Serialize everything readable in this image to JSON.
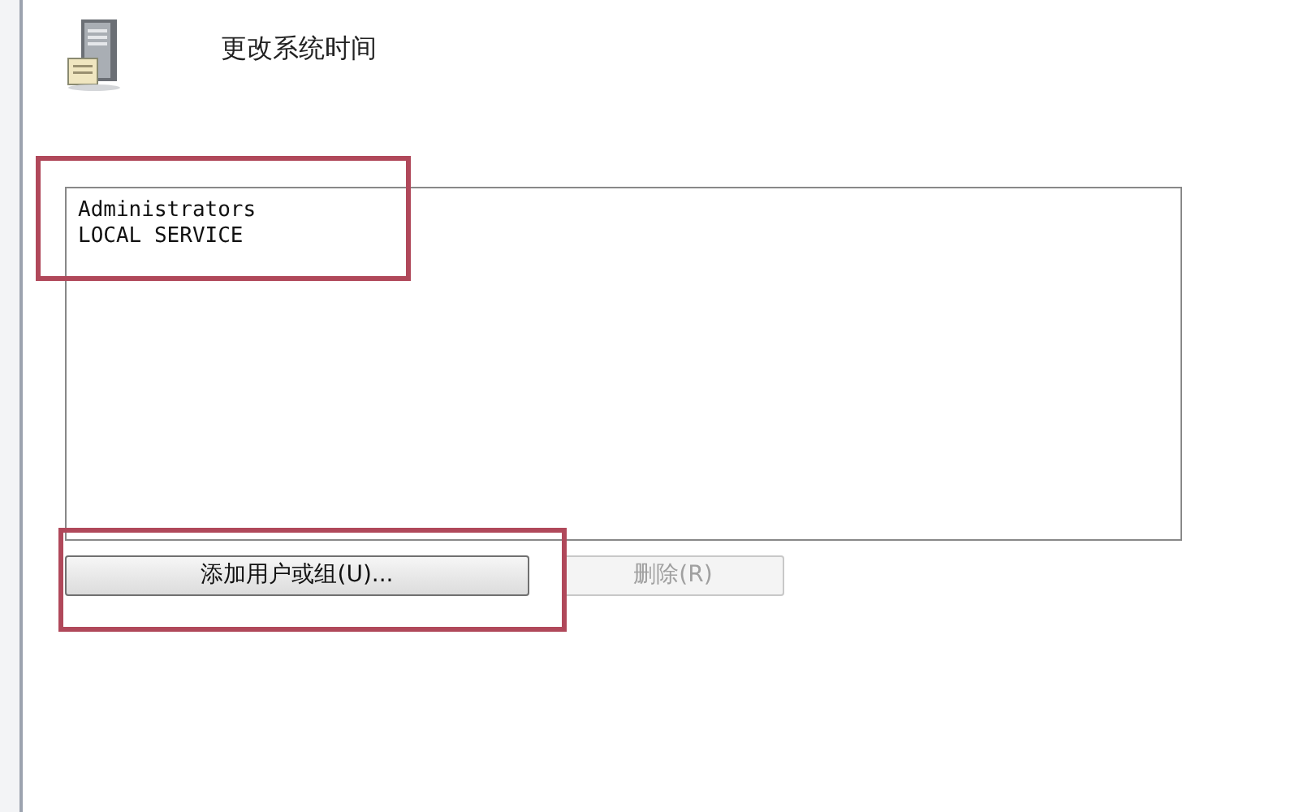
{
  "policy": {
    "title": "更改系统时间"
  },
  "list": {
    "items": [
      {
        "label": "Administrators",
        "selected": false
      },
      {
        "label": "LOCAL SERVICE",
        "selected": false
      }
    ]
  },
  "buttons": [
    {
      "label": "添加用户或组(U)...",
      "disabled": false
    },
    {
      "label": "删除(R)",
      "disabled": true
    }
  ]
}
